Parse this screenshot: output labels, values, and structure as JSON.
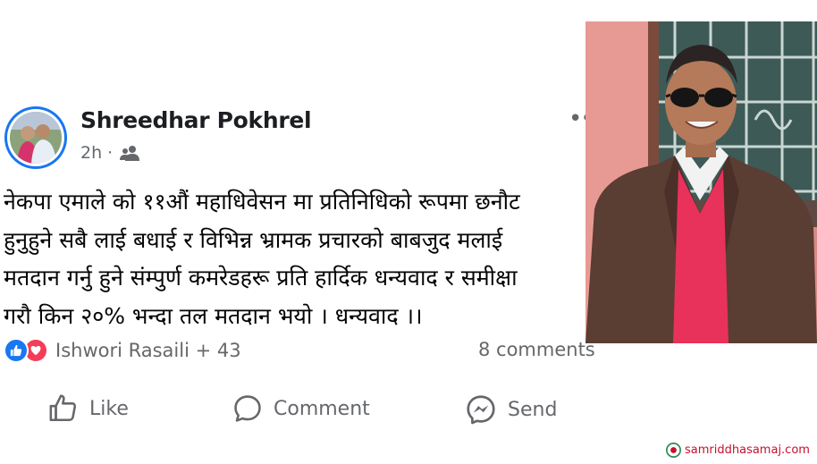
{
  "post": {
    "author": "Shreedhar Pokhrel",
    "time": "2h",
    "dot": "·",
    "more_label": "••",
    "text": "नेकपा एमाले को ११औं महाधिवेसन मा प्रतिनिधिको रूपमा छनौट\nहुनुहुने सबै लाई बधाई र विभिन्न भ्रामक प्रचारको बाबजुद मलाई\nमतदान गर्नु हुने संम्पुर्ण कमरेडहरू प्रति हार्दिक धन्यवाद र समीक्षा\nगरौ किन २०% भन्दा तल मतदान भयो । धन्यवाद ।।",
    "reactors": "Ishwori Rasaili + 43",
    "comments": "8 comments"
  },
  "actions": {
    "like": "Like",
    "comment": "Comment",
    "send": "Send"
  },
  "watermark": "samriddhasamaj.com",
  "icons": {
    "audience": "friends-icon",
    "like_reaction": "thumbs-up-icon",
    "love_reaction": "heart-icon",
    "like_action": "thumbs-up-outline-icon",
    "comment_action": "speech-bubble-icon",
    "send_action": "messenger-icon"
  },
  "colors": {
    "facebook_blue": "#1877f2",
    "love_red": "#f33e58",
    "muted_text": "#65676b",
    "brand_red": "#c8102e"
  }
}
